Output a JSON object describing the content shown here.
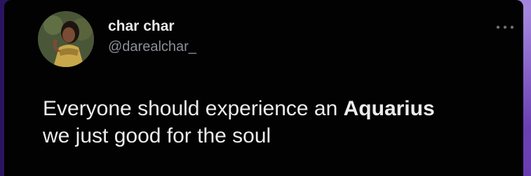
{
  "author": {
    "display_name": "char char",
    "handle": "@darealchar_",
    "avatar_icon": "profile-photo"
  },
  "more_icon": "more-options-icon",
  "tweet": {
    "line1_prefix": "Everyone should experience an ",
    "line1_bold": "Aquarius",
    "line2": "we just good for the soul"
  }
}
